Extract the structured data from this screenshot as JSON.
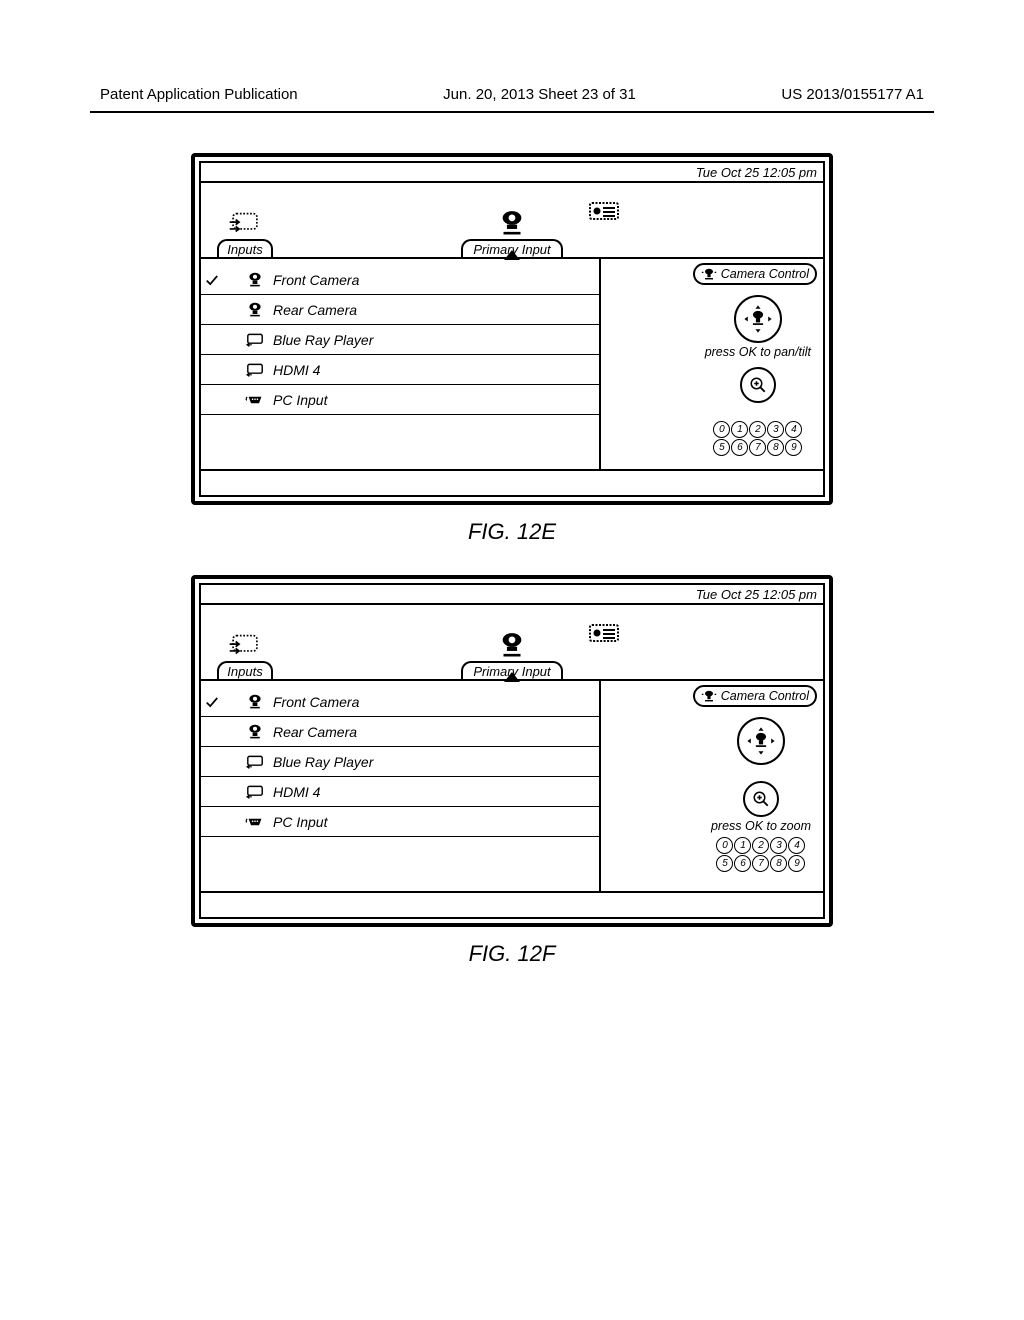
{
  "header": {
    "left": "Patent Application Publication",
    "center": "Jun. 20, 2013  Sheet 23 of 31",
    "right": "US 2013/0155177 A1"
  },
  "status_time": "Tue Oct 25 12:05 pm",
  "tabs": {
    "inputs_label": "Inputs",
    "primary_label": "Primary Input"
  },
  "input_items": [
    {
      "label": "Front Camera",
      "icon": "webcam",
      "selected": true
    },
    {
      "label": "Rear Camera",
      "icon": "webcam",
      "selected": false
    },
    {
      "label": "Blue Ray Player",
      "icon": "hdmi",
      "selected": false
    },
    {
      "label": "HDMI 4",
      "icon": "hdmi",
      "selected": false
    },
    {
      "label": "PC Input",
      "icon": "vga",
      "selected": false
    }
  ],
  "camera_control_label": "Camera Control",
  "fig_e": {
    "caption": "FIG. 12E",
    "hint_pantilt": "press OK to pan/tilt"
  },
  "fig_f": {
    "caption": "FIG. 12F",
    "hint_zoom": "press OK to zoom"
  },
  "presets_row1": [
    "0",
    "1",
    "2",
    "3",
    "4"
  ],
  "presets_row2": [
    "5",
    "6",
    "7",
    "8",
    "9"
  ]
}
